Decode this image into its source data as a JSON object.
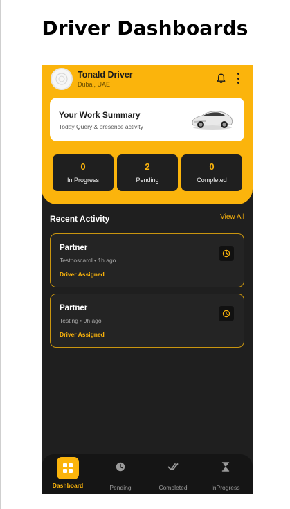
{
  "page_title": "Driver Dashboards",
  "profile": {
    "name": "Tonald Driver",
    "location": "Dubai, UAE"
  },
  "summary": {
    "title": "Your Work Summary",
    "subtitle": "Today Query & presence activity"
  },
  "stats": [
    {
      "value": "0",
      "label": "In Progress"
    },
    {
      "value": "2",
      "label": "Pending"
    },
    {
      "value": "0",
      "label": "Completed"
    }
  ],
  "recent": {
    "title": "Recent Activity",
    "view_all": "View All",
    "items": [
      {
        "title": "Partner",
        "meta": "Testposcarol • 1h ago",
        "status": "Driver Assigned"
      },
      {
        "title": "Partner",
        "meta": "Testing • 9h ago",
        "status": "Driver Assigned"
      }
    ]
  },
  "nav": [
    {
      "label": "Dashboard",
      "icon": "grid-icon",
      "active": true
    },
    {
      "label": "Pending",
      "icon": "clock-icon",
      "active": false
    },
    {
      "label": "Completed",
      "icon": "check-double-icon",
      "active": false
    },
    {
      "label": "InProgress",
      "icon": "hourglass-icon",
      "active": false
    }
  ],
  "colors": {
    "accent": "#fbb40c",
    "background": "#1f1f1f",
    "card": "#242424"
  }
}
